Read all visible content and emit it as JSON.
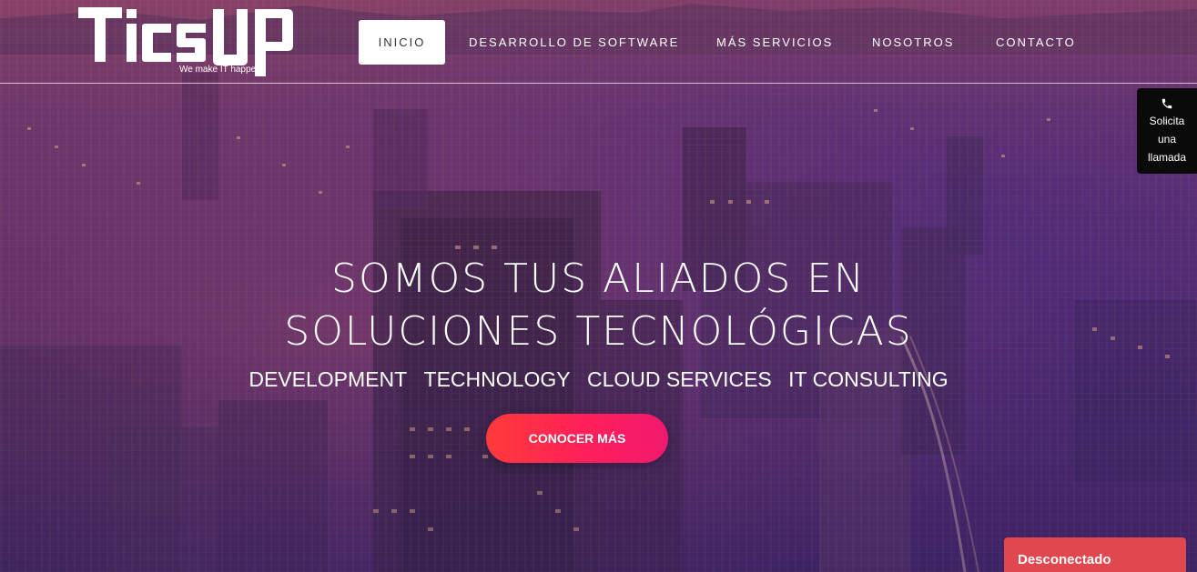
{
  "colors": {
    "accent_start": "#ff3a3a",
    "accent_end": "#f0196e",
    "header_line": "#ffffff",
    "status_badge": "#e0474e",
    "call_widget_bg": "#0a0a0a"
  },
  "logo": {
    "text": "TicsUp",
    "tagline": "We make IT happen"
  },
  "nav": {
    "items": [
      {
        "label": "INICIO",
        "active": true
      },
      {
        "label": "DESARROLLO DE SOFTWARE",
        "active": false
      },
      {
        "label": "MÁS SERVICIOS",
        "active": false
      },
      {
        "label": "NOSOTROS",
        "active": false
      },
      {
        "label": "CONTACTO",
        "active": false
      }
    ]
  },
  "call_widget": {
    "icon": "phone-icon",
    "line1": "Solicita",
    "line2": "una",
    "line3": "llamada"
  },
  "hero": {
    "title_line1": "SOMOS TUS ALIADOS EN",
    "title_line2": "SOLUCIONES TECNOLÓGICAS",
    "services": [
      "DEVELOPMENT",
      "TECHNOLOGY",
      "CLOUD SERVICES",
      "IT CONSULTING"
    ],
    "cta_label": "CONOCER MÁS"
  },
  "chat": {
    "status": "Desconectado"
  }
}
